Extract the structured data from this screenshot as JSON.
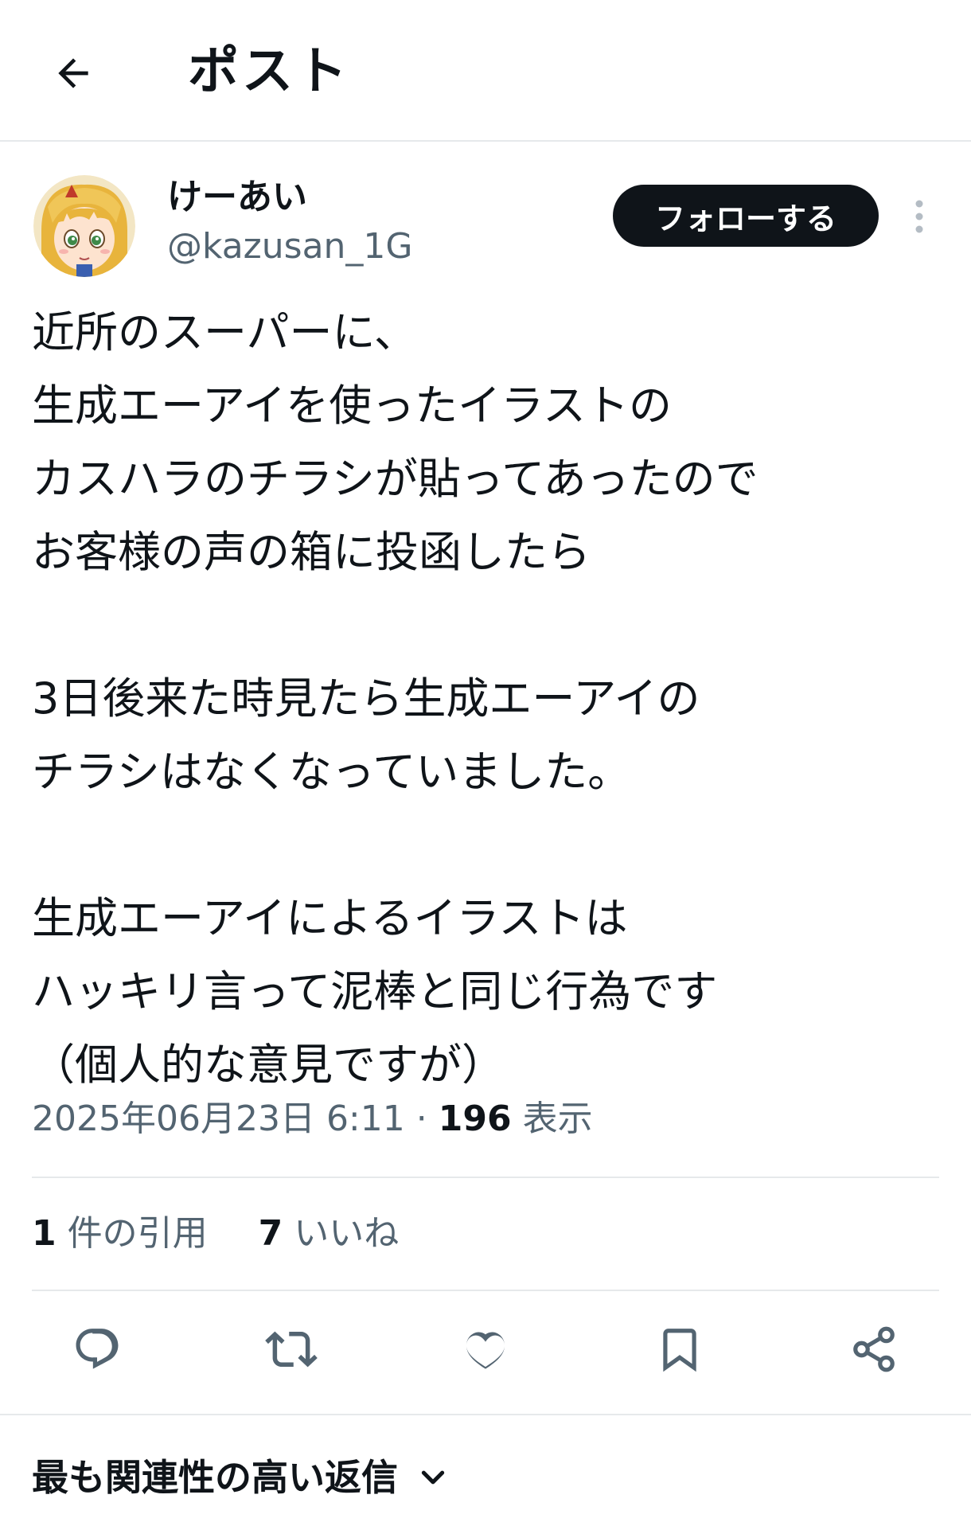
{
  "header": {
    "back_icon": "arrow-left-icon",
    "title": "ポスト"
  },
  "author": {
    "display_name": "けーあい",
    "handle": "@kazusan_1G",
    "follow_label": "フォローする",
    "more_icon": "more-vertical-icon"
  },
  "post": {
    "lines": [
      "近所のスーパーに、",
      "生成エーアイを使ったイラストの",
      "カスハラのチラシが貼ってあったので",
      "お客様の声の箱に投函したら",
      "",
      "3日後来た時見たら生成エーアイの",
      "チラシはなくなっていました。",
      "",
      "生成エーアイによるイラストは",
      "ハッキリ言って泥棒と同じ行為です",
      "（個人的な意見ですが）"
    ]
  },
  "meta": {
    "timestamp": "2025年06月23日 6:11",
    "separator": " · ",
    "views_count": "196",
    "views_label": " 表示"
  },
  "stats": {
    "quotes_count": "1",
    "quotes_label": " 件の引用",
    "likes_count": "7",
    "likes_label": " いいね"
  },
  "actions": {
    "reply_icon": "reply-icon",
    "repost_icon": "repost-icon",
    "like_icon": "heart-icon",
    "bookmark_icon": "bookmark-icon",
    "share_icon": "share-icon"
  },
  "replies": {
    "sort_label": "最も関連性の高い返信"
  },
  "colors": {
    "text": "#0f1419",
    "secondary": "#536471",
    "divider": "#e6e9eb",
    "follow_bg": "#0f1419"
  }
}
